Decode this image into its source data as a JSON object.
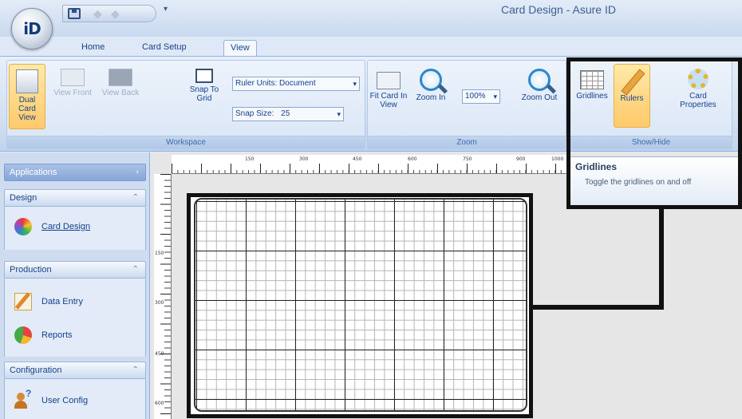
{
  "window": {
    "title": "Card Design - Asure ID",
    "app_logo": "iD"
  },
  "qat": {
    "customize": "▾"
  },
  "tabs": [
    {
      "label": "Home"
    },
    {
      "label": "Card Setup"
    },
    {
      "label": "View"
    }
  ],
  "ribbon": {
    "workspace": {
      "label": "Workspace",
      "dual_card_view": "Dual Card View",
      "view_front": "View Front",
      "view_back": "View Back",
      "snap_to_grid": "Snap To Grid",
      "ruler_units_label": "Ruler Units:",
      "ruler_units_value": "Document",
      "snap_size_label": "Snap Size:",
      "snap_size_value": "25"
    },
    "zoom": {
      "label": "Zoom",
      "fit_card": "Fit Card In View",
      "zoom_in": "Zoom In",
      "zoom_level": "100%",
      "zoom_out": "Zoom Out"
    },
    "show_hide": {
      "label": "Show/Hide",
      "gridlines": "Gridlines",
      "rulers": "Rulers",
      "card_properties": "Card Properties"
    }
  },
  "tooltip": {
    "title": "Gridlines",
    "text": "Toggle the gridlines on and off"
  },
  "sidepanel": {
    "applications": "Applications",
    "sections": [
      {
        "title": "Design",
        "items": [
          {
            "label": "Card Design",
            "icon": "card-design-icon"
          }
        ]
      },
      {
        "title": "Production",
        "items": [
          {
            "label": "Data Entry",
            "icon": "data-entry-icon"
          },
          {
            "label": "Reports",
            "icon": "reports-icon"
          }
        ]
      },
      {
        "title": "Configuration",
        "items": [
          {
            "label": "User Config",
            "icon": "user-config-icon"
          }
        ]
      }
    ]
  },
  "rulers": {
    "horizontal_labels": [
      "150",
      "300",
      "450",
      "600",
      "750",
      "900",
      "1000"
    ],
    "vertical_labels": [
      "150",
      "300",
      "450",
      "600"
    ]
  },
  "colors": {
    "ribbon_highlight": "#ffc96a",
    "callout_border": "#111111",
    "panel_header": "#86a6d6"
  }
}
